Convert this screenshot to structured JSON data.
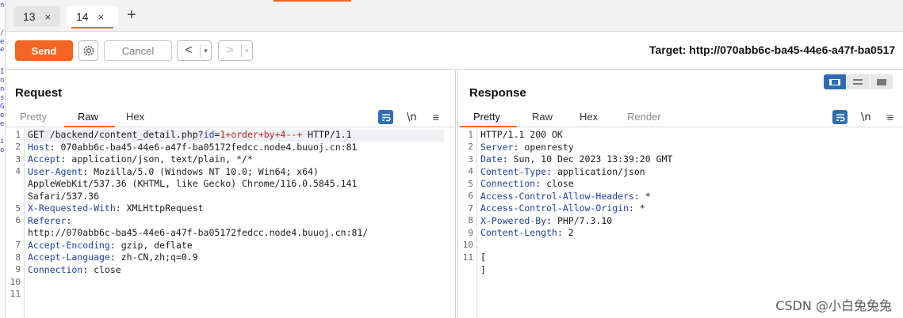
{
  "tabs": [
    {
      "label": "13",
      "close": "×",
      "active": false
    },
    {
      "label": "14",
      "close": "×",
      "active": true
    }
  ],
  "tab_add": "+",
  "toolbar": {
    "send_label": "Send",
    "cancel_label": "Cancel",
    "back_arrow": "<",
    "forward_arrow": ">",
    "dropdown": "▾",
    "target": "Target: http://070abb6c-ba45-44e6-a47f-ba0517"
  },
  "request": {
    "title": "Request",
    "tabs": [
      "Pretty",
      "Raw",
      "Hex"
    ],
    "active_tab": "Raw",
    "newline_icon": "\\n",
    "menu_icon": "≡",
    "line_numbers": [
      "1",
      "2",
      "3",
      "4",
      "",
      "",
      "5",
      "6",
      "",
      "7",
      "8",
      "9",
      "10",
      "11"
    ],
    "request_line": {
      "method_path": "GET /backend/content_detail.php?",
      "param_name": "id",
      "param_eq": "=",
      "param_value": "1+order+by+4--+",
      "version": " HTTP/1.1"
    },
    "headers": [
      {
        "key": "Host",
        "value": ": 070abb6c-ba45-44e6-a47f-ba05172fedcc.node4.buuoj.cn:81"
      },
      {
        "key": "Accept",
        "value": ": application/json, text/plain, */*"
      },
      {
        "key": "User-Agent",
        "value": ": Mozilla/5.0 (Windows NT 10.0; Win64; x64)"
      }
    ],
    "ua_cont1": "AppleWebKit/537.36 (KHTML, like Gecko) Chrome/116.0.5845.141",
    "ua_cont2": "Safari/537.36",
    "headers2": [
      {
        "key": "X-Requested-With",
        "value": ": XMLHttpRequest"
      },
      {
        "key": "Referer",
        "value": ":"
      }
    ],
    "referer_cont": "http://070abb6c-ba45-44e6-a47f-ba05172fedcc.node4.buuoj.cn:81/",
    "headers3": [
      {
        "key": "Accept-Encoding",
        "value": ": gzip, deflate"
      },
      {
        "key": "Accept-Language",
        "value": ": zh-CN,zh;q=0.9"
      },
      {
        "key": "Connection",
        "value": ": close"
      }
    ]
  },
  "response": {
    "title": "Response",
    "tabs": [
      "Pretty",
      "Raw",
      "Hex",
      "Render"
    ],
    "active_tab": "Pretty",
    "newline_icon": "\\n",
    "menu_icon": "≡",
    "line_numbers": [
      "1",
      "2",
      "3",
      "4",
      "5",
      "6",
      "7",
      "8",
      "9",
      "10",
      "11",
      ""
    ],
    "status_line": "HTTP/1.1 200 OK",
    "headers": [
      {
        "key": "Server",
        "value": ": openresty"
      },
      {
        "key": "Date",
        "value": ": Sun, 10 Dec 2023 13:39:20 GMT"
      },
      {
        "key": "Content-Type",
        "value": ": application/json"
      },
      {
        "key": "Connection",
        "value": ": close"
      },
      {
        "key": "Access-Control-Allow-Headers",
        "value": ": *"
      },
      {
        "key": "Access-Control-Allow-Origin",
        "value": ": *"
      },
      {
        "key": "X-Powered-By",
        "value": ": PHP/7.3.10"
      },
      {
        "key": "Content-Length",
        "value": ": 2"
      }
    ],
    "body_open": "[",
    "body_close": "]"
  },
  "watermark": "CSDN @小白兔兔兔",
  "colors": {
    "accent": "#f26522",
    "blue": "#2f6db3",
    "header_key": "#1f3fa3",
    "param_value": "#b3261e"
  }
}
